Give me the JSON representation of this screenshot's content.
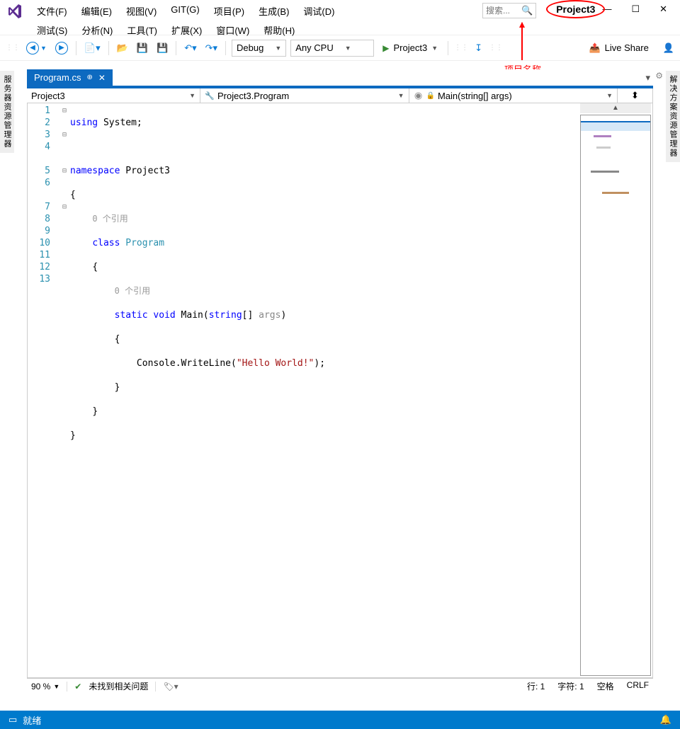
{
  "menu": {
    "file": "文件(F)",
    "edit": "编辑(E)",
    "view": "视图(V)",
    "git": "GIT(G)",
    "project": "项目(P)",
    "build": "生成(B)",
    "debug": "调试(D)",
    "test": "测试(S)",
    "analysis": "分析(N)",
    "tools": "工具(T)",
    "extensions": "扩展(X)",
    "window": "窗口(W)",
    "help": "帮助(H)"
  },
  "search": {
    "placeholder": "搜索..."
  },
  "title_project": "Project3",
  "annotation": "项目名称",
  "toolbar": {
    "config": "Debug",
    "platform": "Any CPU",
    "start_label": "Project3",
    "live_share": "Live Share"
  },
  "side": {
    "left": "服务器资源管理器",
    "right": "解决方案资源管理器"
  },
  "tab": {
    "file": "Program.cs"
  },
  "nav": {
    "project": "Project3",
    "class": "Project3.Program",
    "method": "Main(string[] args)"
  },
  "code": {
    "using_kw": "using",
    "using_ns": " System;",
    "ns_kw": "namespace",
    "ns_name": " Project3",
    "ob": "{",
    "cb": "}",
    "lens0": "0 个引用",
    "class_kw": "class ",
    "class_name": "Program",
    "lens1": "0 个引用",
    "sig1": "static void ",
    "sig2": "Main",
    "sig3": "(",
    "sig4": "string",
    "sig5": "[] ",
    "sig6": "args",
    "sig7": ")",
    "call1": "Console",
    "call2": ".WriteLine(",
    "str": "\"Hello World!\"",
    "call3": ");"
  },
  "lines": [
    "1",
    "2",
    "3",
    "4",
    "5",
    "6",
    "7",
    "8",
    "9",
    "10",
    "11",
    "12",
    "13"
  ],
  "editor_status": {
    "zoom": "90 %",
    "issues": "未找到相关问题",
    "line": "行: 1",
    "char": "字符: 1",
    "indent": "空格",
    "eol": "CRLF"
  },
  "bottom": {
    "ready": "就绪"
  }
}
